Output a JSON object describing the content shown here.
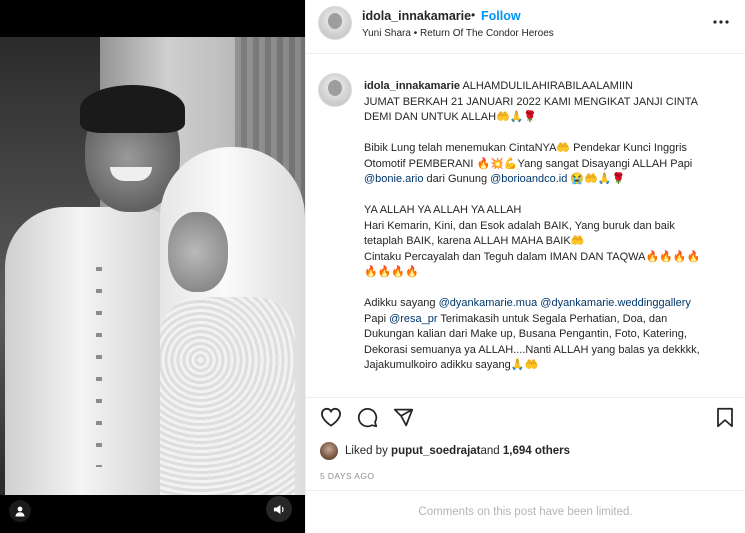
{
  "header": {
    "username": "idola_innakamarie",
    "separator": "•",
    "follow_label": "Follow",
    "audio": "Yuni Shara • Return Of The Condor Heroes",
    "more_icon": "more-horizontal-icon"
  },
  "caption": {
    "username": "idola_innakamarie",
    "line1": " ALHAMDULILAHIRABILAALAMIIN",
    "line2": "JUMAT BERKAH 21 JANUARI 2022 KAMI MENGIKAT JANJI CINTA",
    "line3": "DEMI DAN UNTUK ALLAH🤲🙏🌹",
    "p2_line1": "Bibik Lung telah menemukan CintaNYA🤲 Pendekar Kunci Inggris",
    "p2_line2": "Otomotif PEMBERANI 🔥💥💪Yang sangat Disayangi ALLAH Papi",
    "mention_bonie": "@bonie.ario",
    "p2_line3_mid": " dari Gunung ",
    "mention_borio": "@borioandco.id",
    "p2_line3_end": " 😭🤲🙏🌹",
    "p3_line1": "YA ALLAH YA ALLAH YA ALLAH",
    "p3_line2": "Hari Kemarin, Kini, dan Esok adalah BAIK, Yang buruk dan baik",
    "p3_line3": "tetaplah BAIK, karena ALLAH MAHA BAIK🤲",
    "p3_line4": "Cintaku Percayalah dan Teguh dalam IMAN DAN TAQWA🔥🔥🔥🔥",
    "p3_line5": "🔥🔥🔥🔥",
    "p4_line1_start": "Adikku sayang ",
    "mention_dyanka_mua": "@dyankamarie.mua",
    "mention_dyanka_wedding": "@dyankamarie.weddinggallery",
    "p4_line2_start": "Papi ",
    "mention_resa": "@resa_pr",
    "p4_line2_end": " Terimakasih untuk Segala Perhatian, Doa, dan",
    "p4_line3": "Dukungan kalian dari Make up, Busana Pengantin, Foto, Katering,",
    "p4_line4": "Dekorasi semuanya ya ALLAH....Nanti ALLAH yang balas ya dekkkk,",
    "p4_line5": "Jajakumulkoiro adikku sayang🙏🤲"
  },
  "actions": {
    "like_icon": "heart-icon",
    "comment_icon": "comment-icon",
    "share_icon": "send-icon",
    "save_icon": "bookmark-icon"
  },
  "likes": {
    "prefix": "Liked by ",
    "user": "puput_soedrajat",
    "middle": " and ",
    "count": "1,694 others"
  },
  "timestamp": "5 DAYS AGO",
  "comments_notice": "Comments on this post have been limited.",
  "media": {
    "user_tag_icon": "user-tag-icon",
    "sound_icon": "speaker-icon"
  }
}
